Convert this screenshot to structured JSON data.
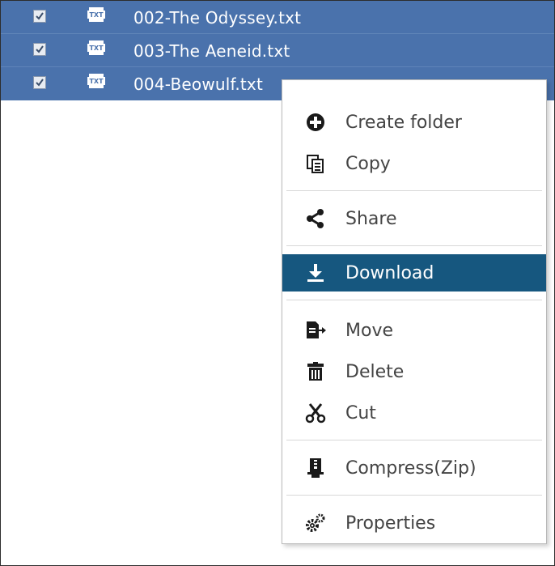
{
  "files": [
    {
      "name": "002-The Odyssey.txt",
      "type_icon": "txt-file-icon",
      "checked": true
    },
    {
      "name": "003-The Aeneid.txt",
      "type_icon": "txt-file-icon",
      "checked": true
    },
    {
      "name": "004-Beowulf.txt",
      "type_icon": "txt-file-icon",
      "checked": true
    }
  ],
  "file_type_label": "TXT",
  "context_menu": {
    "items": [
      {
        "label": "Create folder",
        "icon": "plus-circle-icon"
      },
      {
        "label": "Copy",
        "icon": "copy-icon"
      },
      {
        "label": "Share",
        "icon": "share-icon"
      },
      {
        "label": "Download",
        "icon": "download-icon",
        "highlighted": true
      },
      {
        "label": "Move",
        "icon": "move-icon"
      },
      {
        "label": "Delete",
        "icon": "trash-icon"
      },
      {
        "label": "Cut",
        "icon": "scissors-icon"
      },
      {
        "label": "Compress(Zip)",
        "icon": "compress-icon"
      },
      {
        "label": "Properties",
        "icon": "gears-icon"
      }
    ]
  },
  "colors": {
    "selection": "#4a72ac",
    "menu_highlight": "#16577f"
  }
}
